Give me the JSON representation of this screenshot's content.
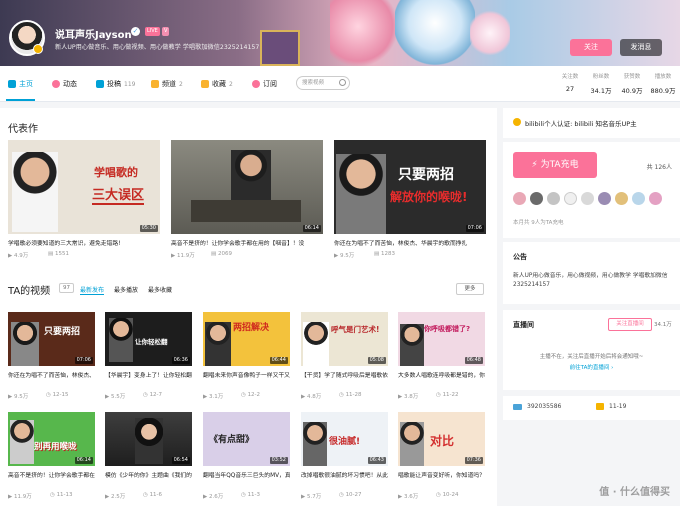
{
  "header": {
    "username": "说耳声乐Jayson",
    "live_badge": "LIVE",
    "level_badge": "V",
    "signature": "新人UP用心做音乐、用心做视频、用心做教学  学唱歌加微信2325214157",
    "follow_label": "关注",
    "message_label": "发消息"
  },
  "nav": {
    "tabs": [
      {
        "label": "主页",
        "count": ""
      },
      {
        "label": "动态",
        "count": ""
      },
      {
        "label": "投稿",
        "count": "119"
      },
      {
        "label": "频道",
        "count": "2"
      },
      {
        "label": "收藏",
        "count": "2"
      },
      {
        "label": "订阅",
        "count": ""
      }
    ],
    "search_placeholder": "搜索视频"
  },
  "stats": [
    {
      "label": "关注数",
      "value": "27"
    },
    {
      "label": "粉丝数",
      "value": "34.1万"
    },
    {
      "label": "获赞数",
      "value": "40.9万"
    },
    {
      "label": "播放数",
      "value": "880.9万"
    }
  ],
  "masterpieces": {
    "title": "代表作",
    "items": [
      {
        "title": "学唱歌必须要知道的三大常识，避免走错路!",
        "thumb_text": "学唱歌的",
        "thumb_text2": "三大误区",
        "duration": "05:30",
        "plays": "4.9万",
        "danmaku": "1551"
      },
      {
        "title": "高音不是挤的！让你学会歌手都在用的【咽音】！没",
        "thumb_text": "",
        "thumb_text2": "",
        "duration": "06:14",
        "plays": "11.9万",
        "danmaku": "2069"
      },
      {
        "title": "你还在为唱不了而苦恼，林俊杰、华晨宇的歌而挣扎",
        "thumb_text": "只要两招",
        "thumb_text2": "解放你的喉咙!",
        "duration": "07:06",
        "plays": "9.5万",
        "danmaku": "1283"
      }
    ]
  },
  "videos": {
    "title": "TA的视频",
    "count": "97",
    "sort_tabs": [
      "最新发布",
      "最多播放",
      "最多收藏"
    ],
    "more_label": "更多",
    "row1": [
      {
        "title": "你还在为唱不了而苦恼，林俊杰、华晨宇的歌而挣扎吗? 两",
        "thumb_text": "只要两招",
        "duration": "07:06",
        "plays": "9.5万",
        "date": "12-15"
      },
      {
        "title": "【华晨宇】变身上了！让你轻松翻唱《好想爱这个世界",
        "thumb_text": "让你轻松翻",
        "duration": "06:36",
        "plays": "5.5万",
        "date": "12-7"
      },
      {
        "title": "翻唱未来你声音像鸭子一样又干又扁的问题!",
        "thumb_text": "两招解决",
        "duration": "06:44",
        "plays": "3.1万",
        "date": "12-2"
      },
      {
        "title": "【干货】学了随式呼吸后是唱歌依然吃得吗？因为你还不懂",
        "thumb_text": "呼气是门艺术!",
        "duration": "05:08",
        "plays": "4.8万",
        "date": "11-28"
      },
      {
        "title": "大多数人唱歌连呼吸都是错的，你知道吗？掌握唱歌呼吸",
        "thumb_text": "你呼吸都错了?",
        "duration": "06:48",
        "plays": "3.8万",
        "date": "11-22"
      }
    ],
    "row2": [
      {
        "title": "高音不是挤的！让你学会歌手都在用的【咽音】！改掉用喉",
        "thumb_text": "别再用喉咙",
        "duration": "06:14",
        "plays": "11.9万",
        "date": "11-13"
      },
      {
        "title": "模仿《少年的你》主题曲《我们的明天》歌曲教学",
        "thumb_text": "",
        "duration": "06:54",
        "plays": "2.5万",
        "date": "11-6"
      },
      {
        "title": "翻唱当年QQ音乐三巨头的MV，真的是又甜又甜!",
        "thumb_text": "《有点甜》",
        "duration": "03:52",
        "plays": "2.6万",
        "date": "11-3"
      },
      {
        "title": "改掉唱歌很油腻的坏习惯吧！从此告别油腻走上人生巅峰",
        "thumb_text": "很油腻!",
        "duration": "06:43",
        "plays": "5.7万",
        "date": "10-27"
      },
      {
        "title": "唱歌能让声音变好听，你知道吗？赶快来让声音变好听吧",
        "thumb_text": "对比",
        "duration": "07:36",
        "plays": "3.6万",
        "date": "10-24"
      }
    ]
  },
  "side": {
    "cert_text": "bilibili个人认证: bilibili 知名音乐UP主",
    "charge_label": "为TA充电",
    "charge_total": "共 126人",
    "charge_note": "本月共 9人为TA充电",
    "announce_title": "公告",
    "announce_text": "新人UP用心做音乐，用心做视频，用心做教学 学唱歌加微信2325214157",
    "live_title": "直播间",
    "live_follow": "关注直播间",
    "live_count": "34.1万",
    "live_off_text": "主播不在，关注后直播开始后将会通知哦~",
    "live_goto": "前往TA的直播间",
    "uid": "392035586",
    "birthday": "11-19"
  },
  "watermark": "值 · 什么值得买",
  "colors": {
    "accent": "#00a1d6",
    "pink": "#fb7299"
  }
}
